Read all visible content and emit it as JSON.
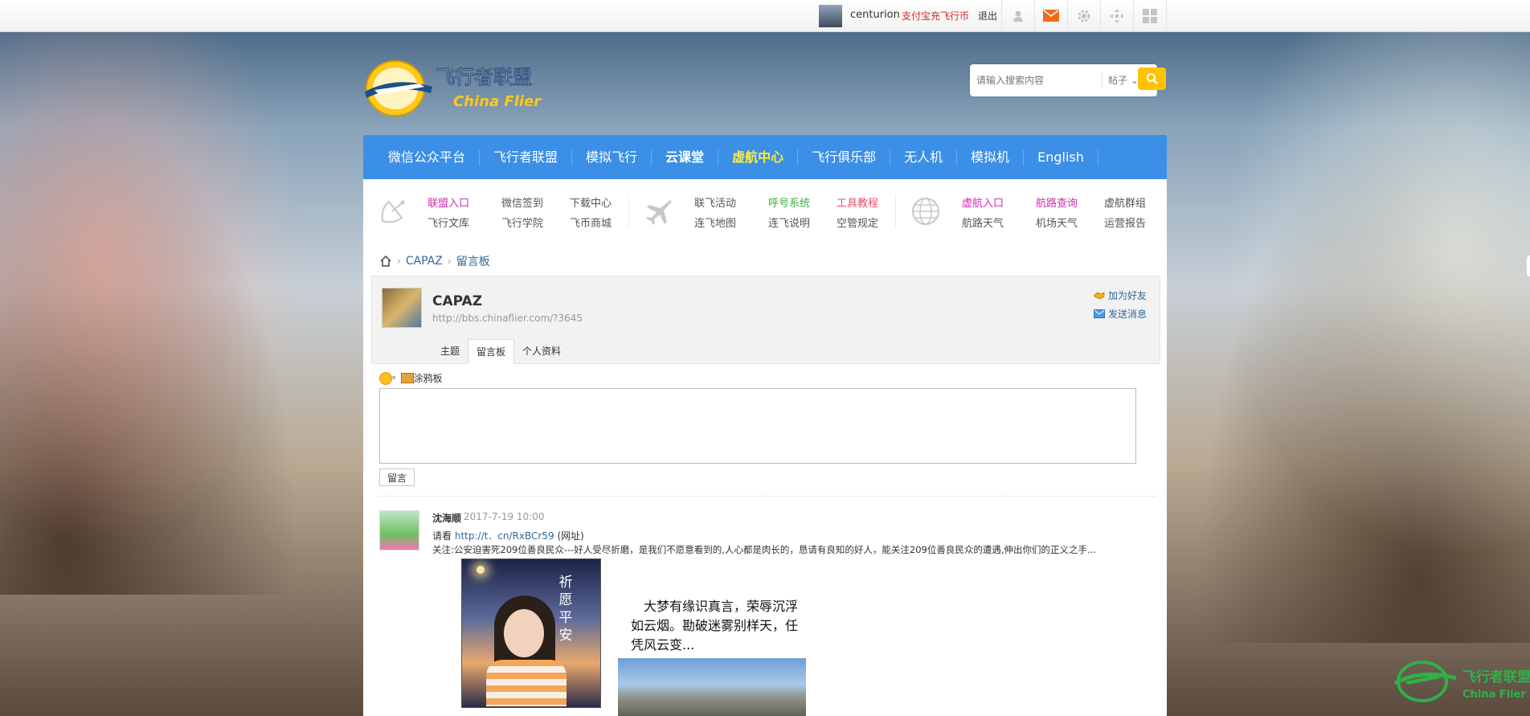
{
  "topbar": {
    "username": "centurion",
    "pay_link": "支付宝充飞行币",
    "logout": "退出",
    "icons": [
      "user-icon",
      "mail-icon",
      "gear-icon",
      "move-icon",
      "grid-icon"
    ]
  },
  "header": {
    "logo_cn": "飞行者联盟",
    "logo_en": "China Flier",
    "search_placeholder": "请输入搜索内容",
    "search_type": "帖子"
  },
  "nav": {
    "items": [
      "微信公众平台",
      "飞行者联盟",
      "模拟飞行",
      "云课堂",
      "虚航中心",
      "飞行俱乐部",
      "无人机",
      "模拟机",
      "English"
    ]
  },
  "quicklinks": {
    "group1": [
      "联盟入口",
      "微信签到",
      "下载中心",
      "飞行文库",
      "飞行学院",
      "飞币商城"
    ],
    "group2": [
      "联飞活动",
      "呼号系统",
      "工具教程",
      "连飞地图",
      "连飞说明",
      "空管规定"
    ],
    "group3": [
      "虚航入口",
      "航路查询",
      "虚航群组",
      "航路天气",
      "机场天气",
      "运营报告"
    ],
    "colors": {
      "pink": "#d02bb2",
      "green": "#3eb03e",
      "red": "#e8506a",
      "nav_blue": "#3c8fe6",
      "highlight": "#ffec3a"
    }
  },
  "breadcrumb": {
    "items": [
      "CAPAZ",
      "留言板"
    ]
  },
  "profile": {
    "name": "CAPAZ",
    "url": "http://bbs.chinaflier.com/?3645",
    "add_friend": "加为好友",
    "send_message": "发送消息",
    "tabs": [
      "主题",
      "留言板",
      "个人资料"
    ],
    "active_tab": "留言板"
  },
  "composer": {
    "graffiti_label": "涂鸦板",
    "submit_label": "留言"
  },
  "entry": {
    "author": "沈海顺",
    "time": "2017-7-19 10:00",
    "line1_prefix": "请看",
    "line1_link": "http://t．cn/RxBCr59",
    "line1_suffix": "(网址)",
    "line2": "关注:公安迫害死209位善良民众---好人受尽折磨，是我们不愿意看到的,人心都是肉长的，恳请有良知的好人，能关注209位善良民众的遭遇,伸出你们的正义之手...",
    "image_text": "祈愿平安",
    "poem": "大梦有缘识真言，荣辱沉浮如云烟。勘破迷雾别样天，任凭风云变..."
  },
  "watermark": {
    "cn": "飞行者联盟",
    "en": "China Flier"
  }
}
